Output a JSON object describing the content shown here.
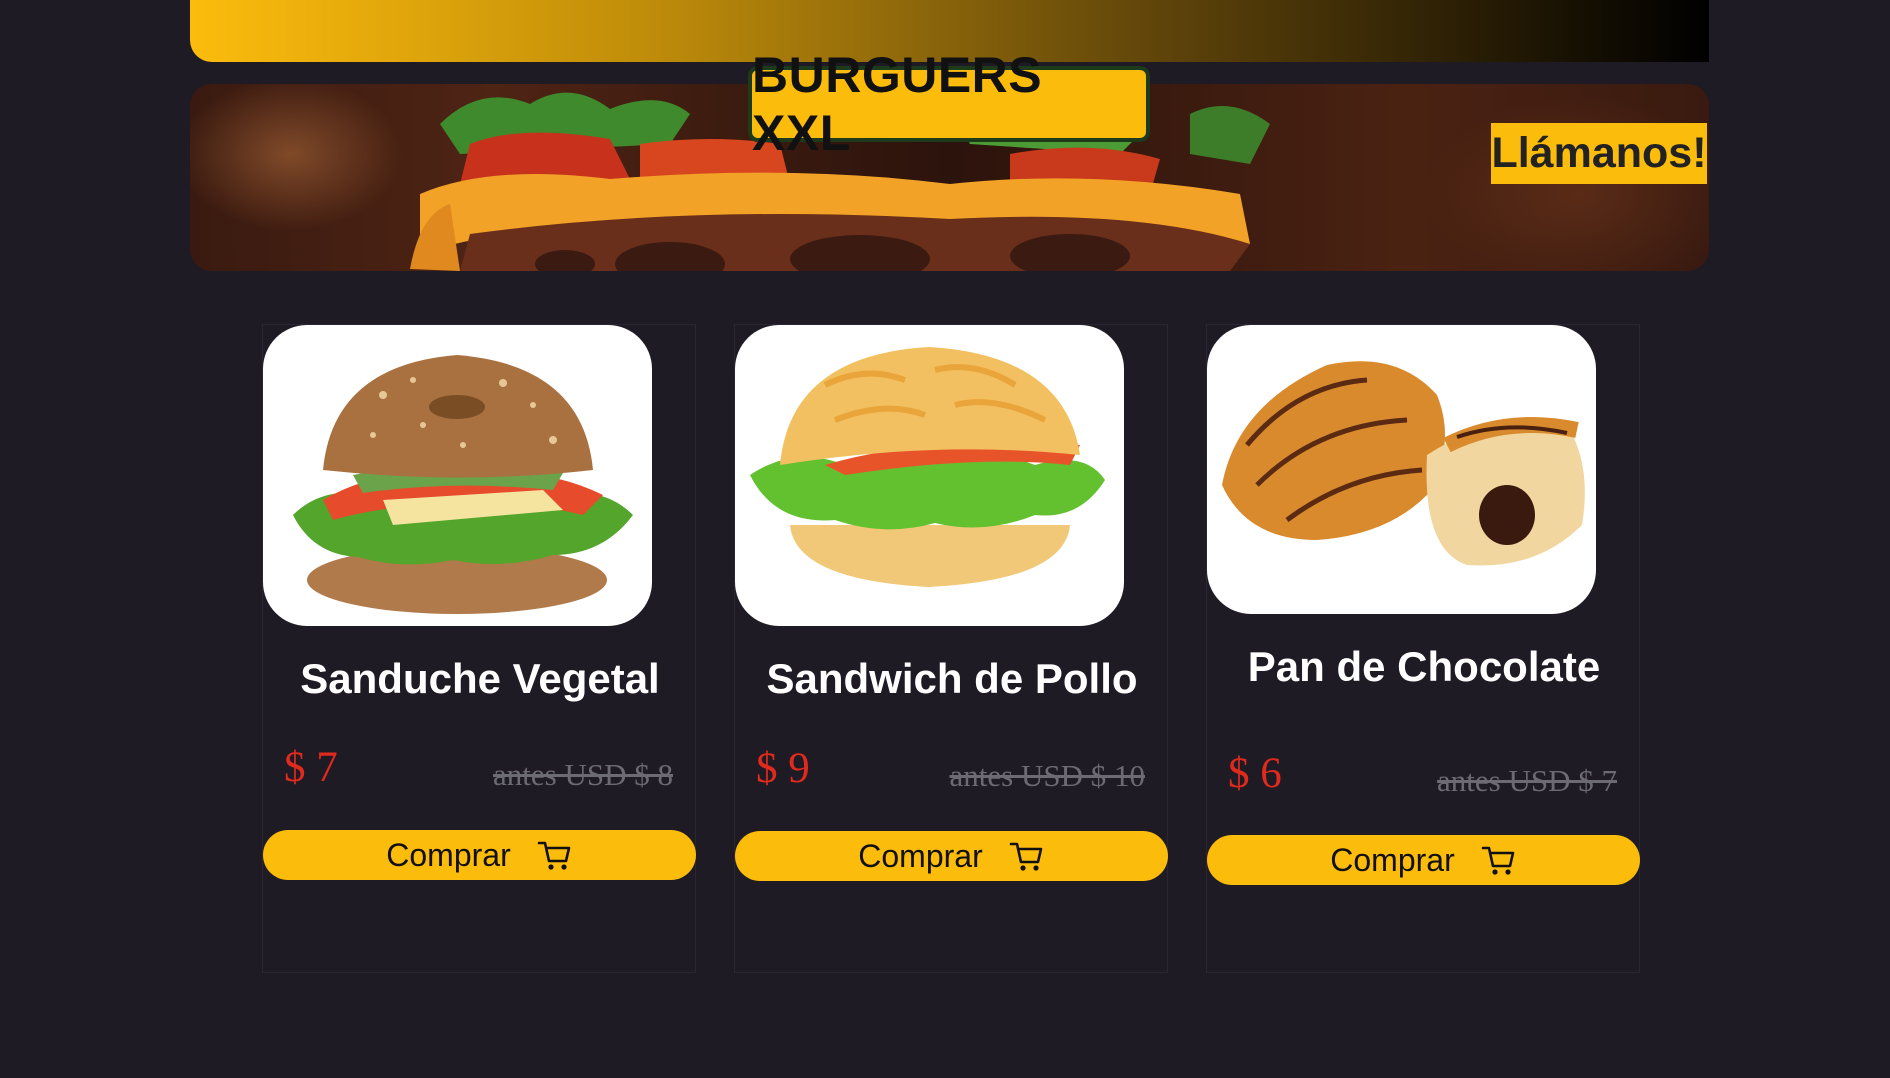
{
  "brand": {
    "logo_text": "BURGUERS XXL",
    "accent_color": "#fcbc0c",
    "background_color": "#1e1b25"
  },
  "hero": {
    "call_label": "Llámanos!"
  },
  "products": [
    {
      "name": "Sanduche Vegetal",
      "price": "$ 7",
      "old_price": "antes USD $ 8",
      "buy_label": "Comprar",
      "image_icon": "bagel-sandwich-image"
    },
    {
      "name": "Sandwich de Pollo",
      "price": "$ 9",
      "old_price": "antes USD $ 10",
      "buy_label": "Comprar",
      "image_icon": "chicken-sandwich-image"
    },
    {
      "name": "Pan de Chocolate",
      "price": "$ 6",
      "old_price": "antes USD $ 7",
      "buy_label": "Comprar",
      "image_icon": "chocolate-croissant-image"
    }
  ],
  "icons": {
    "cart": "shopping-cart-icon"
  }
}
